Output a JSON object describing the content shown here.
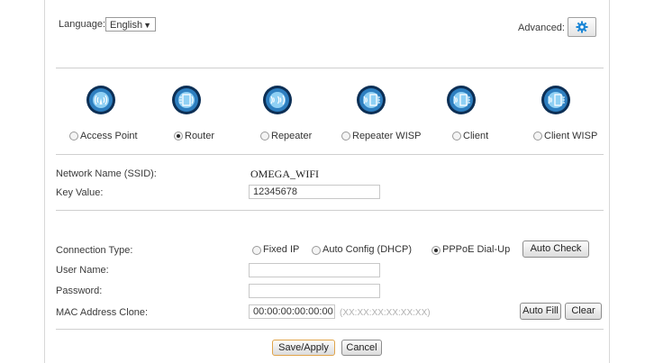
{
  "header": {
    "language_label": "Language:",
    "language_value": "English",
    "advanced_label": "Advanced:",
    "settings_icon": "gear-icon"
  },
  "modes": [
    {
      "label": "Access Point",
      "checked": false,
      "icon": "access-point-icon"
    },
    {
      "label": "Router",
      "checked": true,
      "icon": "router-icon"
    },
    {
      "label": "Repeater",
      "checked": false,
      "icon": "repeater-icon"
    },
    {
      "label": "Repeater WISP",
      "checked": false,
      "icon": "repeater-wisp-icon"
    },
    {
      "label": "Client",
      "checked": false,
      "icon": "client-icon"
    },
    {
      "label": "Client WISP",
      "checked": false,
      "icon": "client-wisp-icon"
    }
  ],
  "wireless": {
    "ssid_label": "Network Name (SSID):",
    "ssid_value": "OMEGA_WIFI",
    "key_label": "Key Value:",
    "key_value": "12345678"
  },
  "connection": {
    "type_label": "Connection Type:",
    "options": [
      {
        "label": "Fixed IP",
        "checked": false
      },
      {
        "label": "Auto Config (DHCP)",
        "checked": false
      },
      {
        "label": "PPPoE Dial-Up",
        "checked": true
      }
    ],
    "auto_check_label": "Auto Check",
    "username_label": "User Name:",
    "username_value": "",
    "password_label": "Password:",
    "password_value": "",
    "mac_label": "MAC Address Clone:",
    "mac_value": "00:00:00:00:00:00",
    "mac_hint": "(XX:XX:XX:XX:XX:XX)",
    "auto_fill_label": "Auto Fill",
    "clear_label": "Clear"
  },
  "actions": {
    "save_label": "Save/Apply",
    "cancel_label": "Cancel"
  },
  "colors": {
    "icon_dark": "#0c2f55",
    "icon_mid": "#2e7fc0",
    "icon_light": "#8fd0f4",
    "gear": "#1b86d6"
  }
}
